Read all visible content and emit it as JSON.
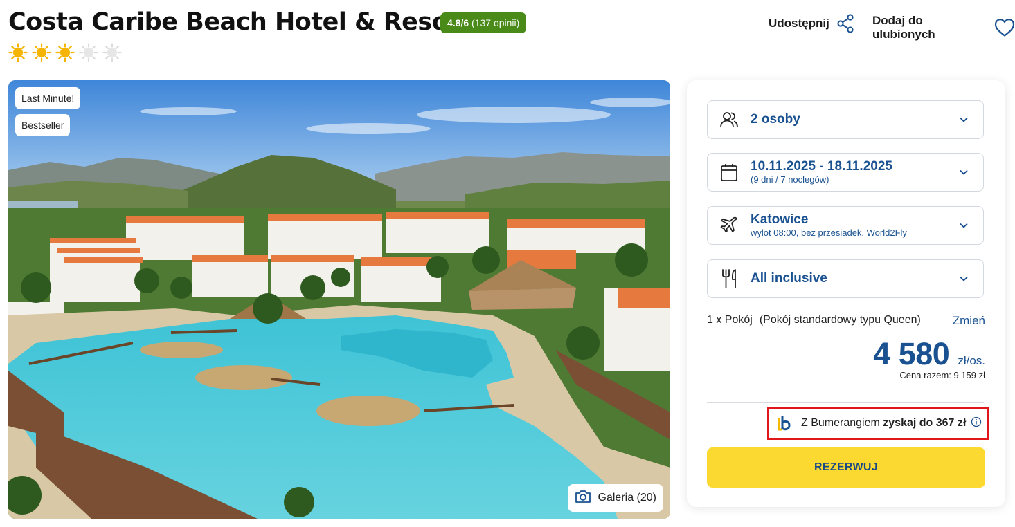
{
  "hotel": {
    "name": "Costa Caribe Beach Hotel & Resort",
    "rating_score": "4.8/6",
    "rating_count": "(137 opinii)",
    "stars_filled": 3,
    "stars_total": 5
  },
  "header": {
    "share_label": "Udostępnij",
    "favorites_label": "Dodaj do ulubionych"
  },
  "photo": {
    "badges": [
      "Last Minute!",
      "Bestseller"
    ],
    "gallery_label": "Galeria (20)"
  },
  "booking": {
    "travelers": "2 osoby",
    "dates": "10.11.2025 - 18.11.2025",
    "dates_detail": "(9 dni / 7 noclegów)",
    "departure_city": "Katowice",
    "departure_detail": "wylot 08:00, bez przesiadek, World2Fly",
    "board": "All inclusive",
    "room_count": "1 x Pokój",
    "room_type": "(Pokój standardowy typu Queen)",
    "change_label": "Zmień",
    "price": "4 580",
    "price_unit": "zł/os.",
    "total_price": "Cena razem: 9 159 zł",
    "bumerang_text": "Z Bumerangiem",
    "bumerang_bold": "zyskaj do 367 zł",
    "reserve_label": "REZERWUJ"
  },
  "colors": {
    "accent_blue": "#1a5291",
    "rating_green": "#4a8a19",
    "reserve_yellow": "#fcd931",
    "star_gold": "#f4b400",
    "highlight_red": "#e0161b"
  }
}
